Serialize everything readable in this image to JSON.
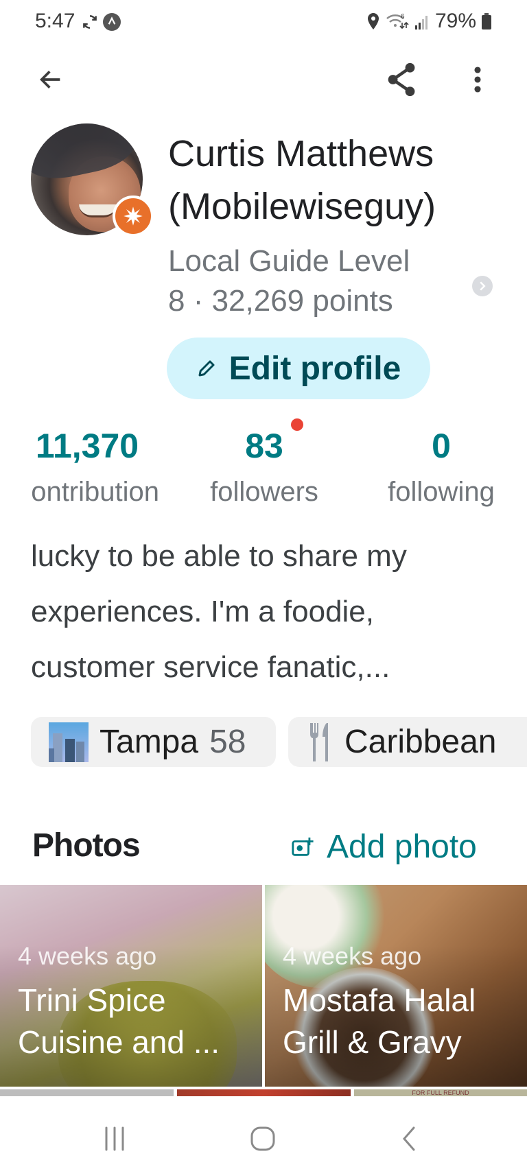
{
  "status_bar": {
    "time": "5:47",
    "left_icons": [
      "sync-icon",
      "vpn-icon"
    ],
    "right_icons": [
      "location-icon",
      "wifi-6-icon",
      "signal-icon"
    ],
    "battery": "79%"
  },
  "top_bar": {
    "back_icon": "arrow-back-icon",
    "share_icon": "share-icon",
    "more_icon": "more-vert-icon"
  },
  "profile": {
    "name_line1": "Curtis Matthews",
    "name_line2": "(Mobilewiseguy)",
    "badge_icon": "local-guide-star-icon",
    "level_line1": "Local Guide Level",
    "level_line2": "8 · 32,269 points",
    "edit_button": "Edit profile"
  },
  "stats": [
    {
      "value": "11,370",
      "label": "ontribution"
    },
    {
      "value": "83",
      "label": "followers"
    },
    {
      "value": "0",
      "label": "following"
    }
  ],
  "bio": {
    "lines": [
      "lucky to be able to share my",
      "experiences. I'm a foodie,",
      "customer service fanatic,..."
    ]
  },
  "chips": [
    {
      "icon": "cityscape-icon",
      "label": "Tampa",
      "count": "58"
    },
    {
      "icon": "fork-knife-icon",
      "label": "Caribbean",
      "count": ""
    }
  ],
  "photos_section": {
    "title": "Photos",
    "add_label": "Add photo",
    "items": [
      {
        "ago": "4 weeks ago",
        "title": "Trini Spice Cuisine and ..."
      },
      {
        "ago": "4 weeks ago",
        "title": "Mostafa Halal Grill & Gravy"
      }
    ],
    "thumb_caption": "FOR FULL REFUND"
  },
  "colors": {
    "accent": "#007b83",
    "edit_button_bg": "#d3f4fc",
    "edit_button_text": "#004a55",
    "badge": "#e8702a",
    "notification_dot": "#ea4335"
  }
}
